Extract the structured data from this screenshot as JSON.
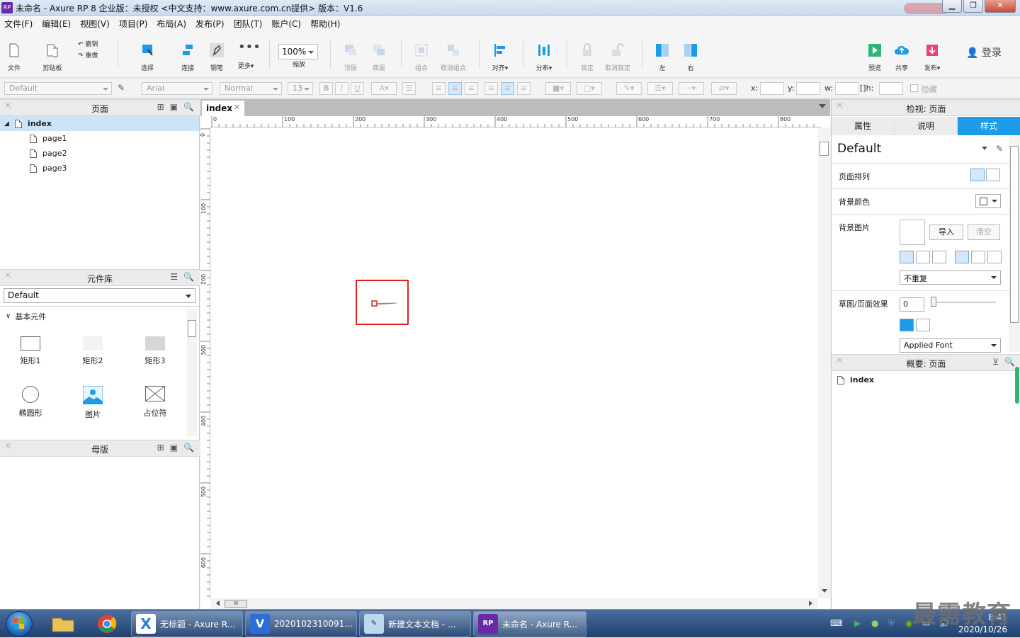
{
  "window": {
    "title": "未命名 - Axure RP 8 企业版：未授权     <中文支持：www.axure.com.cn提供> 版本：V1.6"
  },
  "menu": [
    "文件(F)",
    "编辑(E)",
    "视图(V)",
    "项目(P)",
    "布局(A)",
    "发布(P)",
    "团队(T)",
    "账户(C)",
    "帮助(H)"
  ],
  "toolbar": {
    "file": "文件",
    "clipboard": "剪贴板",
    "undo": "撤销",
    "redo": "重做",
    "select": "选择",
    "connect": "连接",
    "pen": "钢笔",
    "more": "更多▾",
    "zoom_value": "100%",
    "zoom": "缩放",
    "top": "顶层",
    "bottom": "底层",
    "group": "组合",
    "ungroup": "取消组合",
    "align": "对齐▾",
    "distribute": "分布▾",
    "lock": "锁定",
    "unlock": "取消锁定",
    "left": "左",
    "right": "右",
    "preview": "预览",
    "share": "共享",
    "publish": "发布▾",
    "login": "登录"
  },
  "format": {
    "style": "Default",
    "font": "Arial",
    "weight": "Normal",
    "size": "13",
    "x": "x:",
    "y": "y:",
    "w": "w:",
    "h": "h:",
    "hide": "隐藏"
  },
  "pages_panel": {
    "title": "页面",
    "items": [
      "index",
      "page1",
      "page2",
      "page3"
    ]
  },
  "library_panel": {
    "title": "元件库",
    "library": "Default",
    "category": "基本元件",
    "widgets": [
      "矩形1",
      "矩形2",
      "矩形3",
      "椭圆形",
      "图片",
      "占位符"
    ]
  },
  "masters_panel": {
    "title": "母版"
  },
  "canvas": {
    "tab": "index",
    "hticks": [
      "0",
      "100",
      "200",
      "300",
      "400",
      "500",
      "600",
      "700",
      "800"
    ],
    "vticks": [
      "0",
      "100",
      "200",
      "300",
      "400",
      "500",
      "600"
    ]
  },
  "inspector": {
    "title": "检视: 页面",
    "tabs": [
      "属性",
      "说明",
      "样式"
    ],
    "style_name": "Default",
    "page_align": "页面排列",
    "bg_color": "背景颜色",
    "bg_image": "背景图片",
    "import": "导入",
    "clear": "清空",
    "repeat": "不重复",
    "sketch": "草图/页面效果",
    "sketch_value": "0",
    "applied_font": "Applied Font"
  },
  "outline": {
    "title": "概要: 页面",
    "item": "index"
  },
  "taskbar": {
    "items": [
      "无标题 - Axure R...",
      "2020102310091...",
      "新建文本文档 - ...",
      "未命名 - Axure R..."
    ],
    "time": "8:41",
    "date": "2020/10/26"
  },
  "watermark": "最需教育",
  "colors": {
    "accent": "#1e9be6",
    "selection": "#e02020"
  }
}
